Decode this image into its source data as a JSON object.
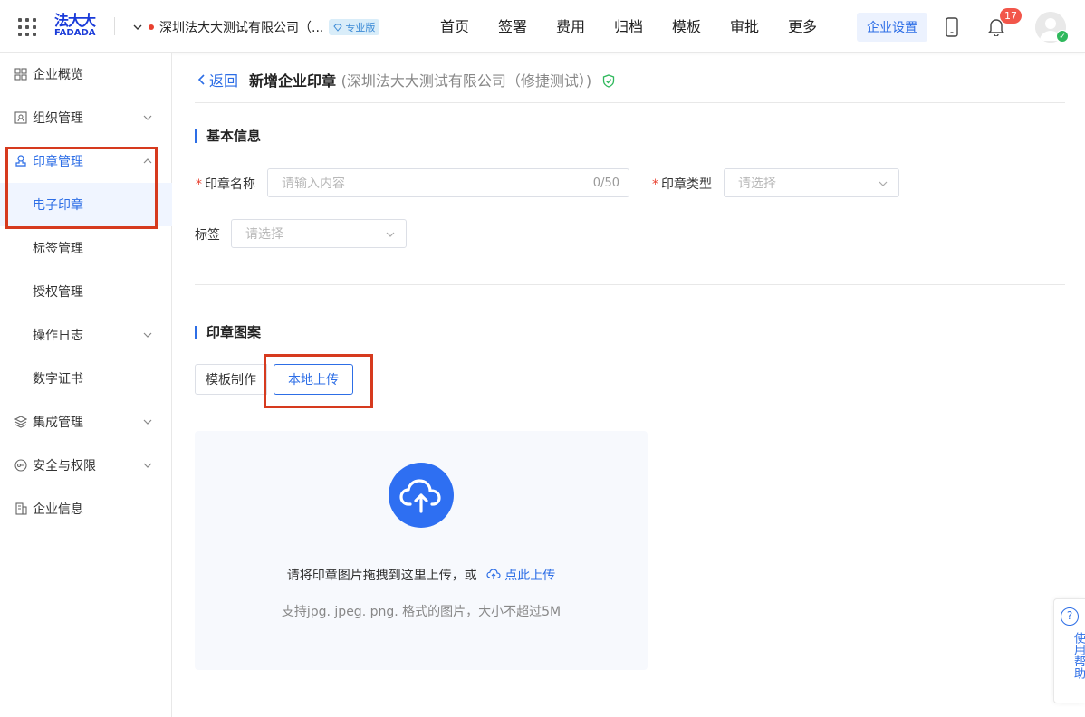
{
  "header": {
    "logo_line1": "法大大",
    "logo_line2": "FADADA",
    "company_name": "深圳法大大测试有限公司（...",
    "edition_badge": "专业版",
    "nav": [
      "首页",
      "签署",
      "费用",
      "归档",
      "模板",
      "审批",
      "更多"
    ],
    "settings_button": "企业设置",
    "notification_count": "17"
  },
  "sidebar": {
    "items": [
      {
        "label": "企业概览",
        "icon": "overview-icon"
      },
      {
        "label": "组织管理",
        "icon": "org-icon"
      },
      {
        "label": "印章管理",
        "icon": "seal-icon"
      },
      {
        "label": "电子印章"
      },
      {
        "label": "标签管理"
      },
      {
        "label": "授权管理"
      },
      {
        "label": "操作日志"
      },
      {
        "label": "数字证书"
      },
      {
        "label": "集成管理",
        "icon": "integration-icon"
      },
      {
        "label": "安全与权限",
        "icon": "security-icon"
      },
      {
        "label": "企业信息",
        "icon": "company-info-icon"
      }
    ]
  },
  "page": {
    "back_label": "返回",
    "title": "新增企业印章",
    "subtitle": "(深圳法大大测试有限公司（修捷测试）)"
  },
  "basic_info": {
    "section_title": "基本信息",
    "seal_name_label": "印章名称",
    "seal_name_placeholder": "请输入内容",
    "seal_name_count": "0/50",
    "seal_type_label": "印章类型",
    "seal_type_placeholder": "请选择",
    "tag_label": "标签",
    "tag_placeholder": "请选择"
  },
  "seal_pattern": {
    "section_title": "印章图案",
    "tab_template": "模板制作",
    "tab_upload": "本地上传",
    "upload_text": "请将印章图片拖拽到这里上传，或",
    "upload_link": "点此上传",
    "upload_hint": "支持jpg. jpeg. png. 格式的图片，大小不超过5M"
  },
  "help": {
    "label": "使用帮助"
  },
  "colors": {
    "accent": "#2d6ee6",
    "highlight_box": "#d63a1e",
    "badge_red": "#f2564a"
  }
}
